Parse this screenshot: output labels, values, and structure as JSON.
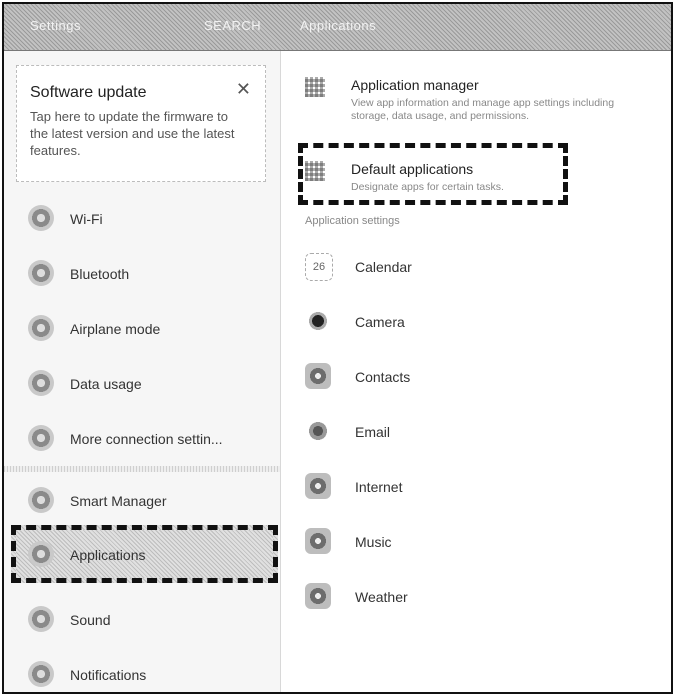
{
  "header": {
    "left_title": "Settings",
    "search": "SEARCH",
    "section_title": "Applications"
  },
  "left_panel": {
    "update_card": {
      "title": "Software update",
      "description": "Tap here to update the firmware to the latest version and use the latest features.",
      "close": "✕"
    },
    "items": [
      {
        "label": "Wi-Fi"
      },
      {
        "label": "Bluetooth"
      },
      {
        "label": "Airplane mode"
      },
      {
        "label": "Data usage"
      },
      {
        "label": "More connection settin..."
      },
      {
        "label": "Smart Manager"
      },
      {
        "label": "Applications"
      },
      {
        "label": "Sound"
      },
      {
        "label": "Notifications"
      }
    ]
  },
  "right_panel": {
    "app_manager": {
      "title": "Application manager",
      "subtitle": "View app information and manage app settings including storage, data usage, and permissions."
    },
    "default_apps": {
      "title": "Default applications",
      "subtitle": "Designate apps for certain tasks."
    },
    "section_label": "Application settings",
    "apps": [
      {
        "label": "Calendar",
        "icon": "calendar-icon"
      },
      {
        "label": "Camera",
        "icon": "camera-icon"
      },
      {
        "label": "Contacts",
        "icon": "contacts-icon"
      },
      {
        "label": "Email",
        "icon": "email-icon"
      },
      {
        "label": "Internet",
        "icon": "internet-icon"
      },
      {
        "label": "Music",
        "icon": "music-icon"
      },
      {
        "label": "Weather",
        "icon": "weather-icon"
      }
    ],
    "calendar_day": "26"
  }
}
